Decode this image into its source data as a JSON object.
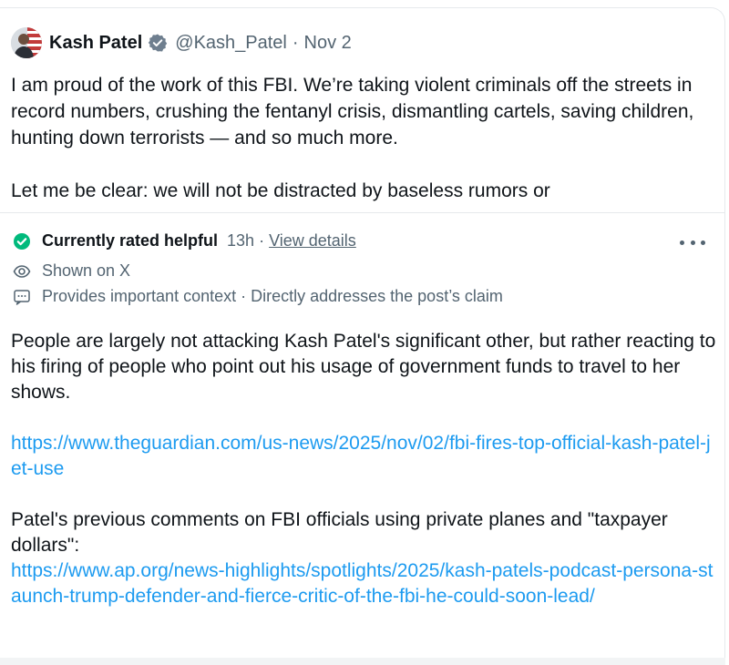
{
  "post": {
    "author_name": "Kash Patel",
    "handle": "@Kash_Patel",
    "separator": "·",
    "date": "Nov 2",
    "paragraph_1": "I am proud of the work of this FBI. We’re taking violent criminals off the streets in record numbers, crushing the fentanyl crisis, dismantling cartels, saving children, hunting down terrorists — and so much more.",
    "paragraph_2": "Let me be clear: we will not be distracted by baseless rumors or",
    "icons": {
      "avatar": "avatar",
      "verified": "verified-badge-icon"
    }
  },
  "note": {
    "status_label": "Currently rated helpful",
    "time": "13h",
    "separator": "·",
    "details_link": "View details",
    "shown_on": "Shown on X",
    "context_label": "Provides important context · Directly addresses the post’s claim",
    "body_paragraph_1": "People are largely not attacking Kash Patel's significant other, but rather reacting to his firing of people who point out his usage of government funds to travel to her shows.",
    "link_1": "https://www.theguardian.com/us-news/2025/nov/02/fbi-fires-top-official-kash-patel-jet-use",
    "body_paragraph_2": "Patel's previous comments on FBI officials using private planes and \"taxpayer dollars\":",
    "link_2": "https://www.ap.org/news-highlights/spotlights/2025/kash-patels-podcast-persona-staunch-trump-defender-and-fierce-critic-of-the-fbi-he-could-soon-lead/",
    "icons": {
      "status": "check-circle-icon",
      "shown": "eye-icon",
      "context": "message-icon",
      "more": "more-horizontal-icon"
    }
  },
  "colors": {
    "text": "#0f1419",
    "secondary": "#536471",
    "link": "#1d9bf0",
    "helpful_green": "#00ba7c",
    "verified_blue": "#1d9bf0"
  }
}
